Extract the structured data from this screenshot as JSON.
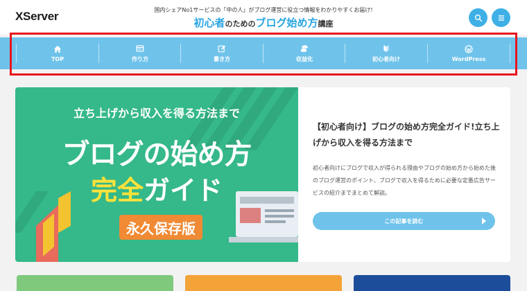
{
  "header": {
    "logo": "XServer",
    "tagline": "国内シェアNo1サービスの「中の人」がブログ運営に役立つ情報をわかりやすくお届け!",
    "title_part1": "初心者",
    "title_part2": "のための",
    "title_part3": "ブログ始め方",
    "title_part4": "講座",
    "search_icon": "search-icon",
    "menu_icon": "hamburger-menu-icon"
  },
  "nav": {
    "items": [
      {
        "label": "TOP",
        "icon": "home-icon"
      },
      {
        "label": "作り方",
        "icon": "browser-window-icon"
      },
      {
        "label": "書き方",
        "icon": "pencil-edit-icon"
      },
      {
        "label": "収益化",
        "icon": "coins-icon"
      },
      {
        "label": "初心者向け",
        "icon": "beginner-mark-icon"
      },
      {
        "label": "WordPress",
        "icon": "wordpress-icon"
      }
    ],
    "highlight_color": "#e8141c",
    "bar_color": "#6fc3eb"
  },
  "hero": {
    "top_text": "立ち上げから収入を得る方法まで",
    "main_text": "ブログの始め方",
    "sub_text_yellow": "完全",
    "sub_text_white": "ガイド",
    "badge": "永久保存版"
  },
  "article": {
    "title": "【初心者向け】ブログの始め方完全ガイド!立ち上げから収入を得る方法まで",
    "excerpt": "初心者向けにブログで収入が得られる理由やブログの始め方から始めた後のブログ運営のポイント、ブログで収入を得るために必要な定番広告サービスの紹介までまとめて解説。",
    "read_more": "この記事を読む"
  },
  "colors": {
    "accent": "#29a5e3",
    "hero_green": "#35b88a",
    "badge_orange": "#f08a34",
    "yellow": "#ffe23a"
  }
}
